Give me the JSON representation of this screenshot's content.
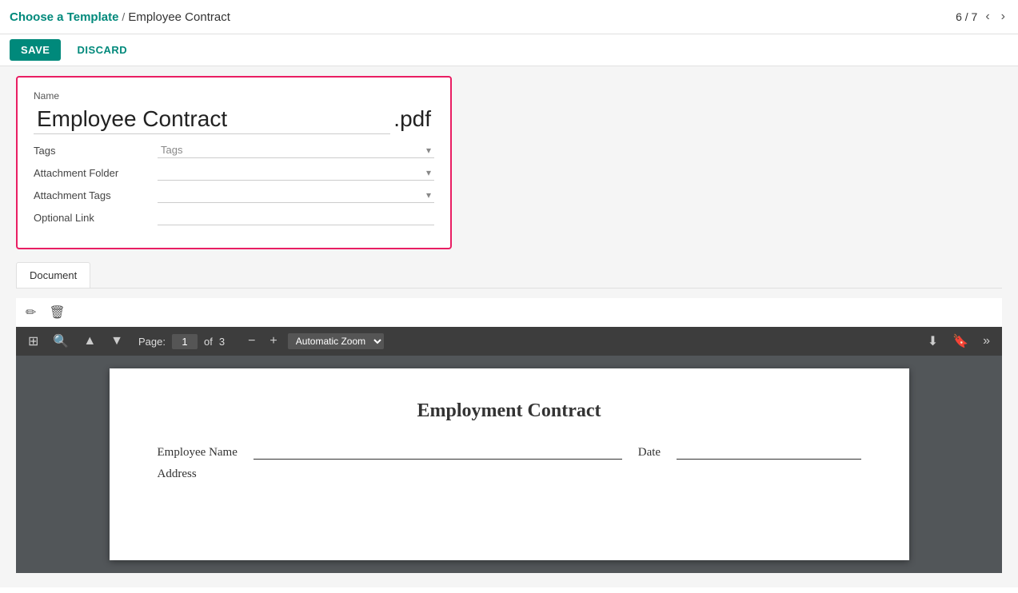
{
  "breadcrumb": {
    "link_label": "Choose a Template",
    "separator": "/",
    "current": "Employee Contract"
  },
  "toolbar": {
    "save_label": "SAVE",
    "discard_label": "DISCARD"
  },
  "pagination": {
    "current": "6",
    "total": "7",
    "display": "6 / 7"
  },
  "form": {
    "name_label": "Name",
    "name_value": "Employee Contract",
    "name_extension": ".pdf",
    "tags_label": "Tags",
    "tags_placeholder": "Tags",
    "attachment_folder_label": "Attachment Folder",
    "attachment_folder_placeholder": "",
    "attachment_tags_label": "Attachment Tags",
    "attachment_tags_placeholder": "",
    "optional_link_label": "Optional Link",
    "optional_link_placeholder": ""
  },
  "doc_tab": {
    "label": "Document"
  },
  "pdf_toolbar": {
    "page_label": "Page:",
    "page_current": "1",
    "page_total": "3",
    "of_label": "of",
    "zoom_label": "Automatic Zoom"
  },
  "pdf_content": {
    "title": "Employment Contract",
    "field1_label": "Employee Name",
    "field2_label": "Date",
    "field3_label": "Address"
  },
  "icons": {
    "pencil": "✏",
    "trash": "🗑",
    "sidebar_toggle": "▣",
    "search": "🔍",
    "prev_page": "▲",
    "next_page": "▼",
    "zoom_out": "−",
    "zoom_in": "+",
    "download": "⬇",
    "bookmark": "🔖",
    "more": "»",
    "chevron_left": "‹",
    "chevron_right": "›"
  }
}
